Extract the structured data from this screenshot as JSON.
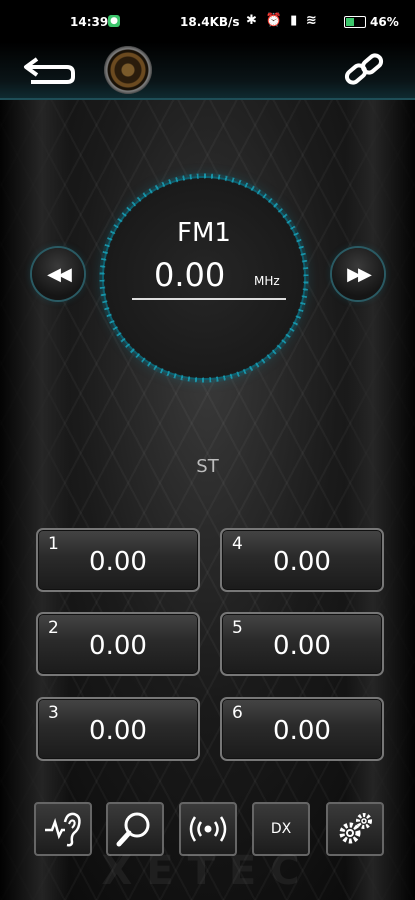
{
  "status_bar": {
    "time": "14:39",
    "net_speed": "18.4KB/s",
    "battery_pct": "46",
    "battery_suffix": "%",
    "battery_level": 0.46,
    "accent": "#3cc56b"
  },
  "header": {
    "back_icon": "back-arrow-icon",
    "speaker_icon": "speaker-icon",
    "link_icon": "link-icon"
  },
  "tuner": {
    "band": "FM1",
    "frequency": "0.00",
    "unit": "MHz",
    "stereo": "ST",
    "seek_back_glyph": "◀◀",
    "seek_forward_glyph": "▶▶",
    "accent": "#1aa6bd"
  },
  "presets": [
    {
      "number": "1",
      "value": "0.00"
    },
    {
      "number": "2",
      "value": "0.00"
    },
    {
      "number": "3",
      "value": "0.00"
    },
    {
      "number": "4",
      "value": "0.00"
    },
    {
      "number": "5",
      "value": "0.00"
    },
    {
      "number": "6",
      "value": "0.00"
    }
  ],
  "toolbar": {
    "dx_label": "DX",
    "icons": [
      "ear-icon",
      "search-icon",
      "broadcast-icon",
      "settings-icon"
    ]
  },
  "brand": "XETEC"
}
